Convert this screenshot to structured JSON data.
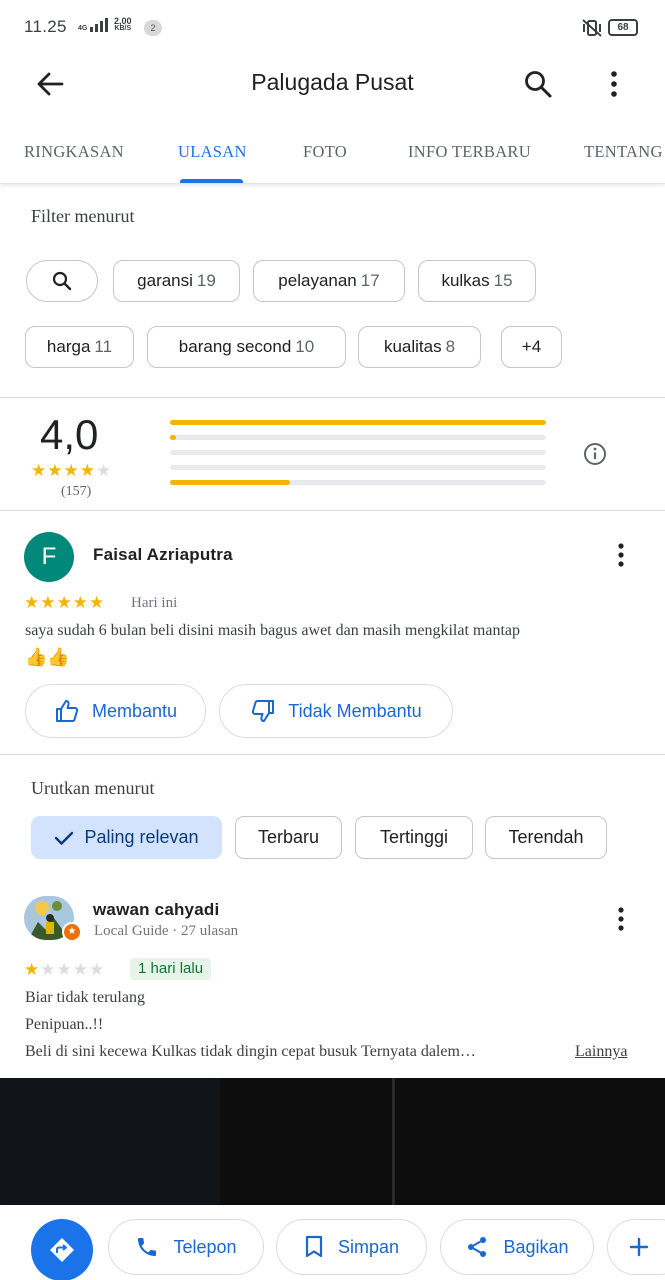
{
  "status_bar": {
    "time": "11.25",
    "network": "4G",
    "speed_value": "2,00",
    "speed_unit": "KB/S",
    "notification_count": "2",
    "battery": "68"
  },
  "app_bar": {
    "title": "Palugada Pusat",
    "icons": [
      "arrow-back-icon",
      "search-icon",
      "more-vert-icon"
    ]
  },
  "tabs": [
    {
      "label": "RINGKASAN",
      "active": false
    },
    {
      "label": "ULASAN",
      "active": true
    },
    {
      "label": "FOTO",
      "active": false
    },
    {
      "label": "INFO TERBARU",
      "active": false
    },
    {
      "label": "TENTANG",
      "active": false
    }
  ],
  "filter": {
    "label": "Filter menurut",
    "chips": [
      {
        "label": "garansi",
        "count": "19"
      },
      {
        "label": "pelayanan",
        "count": "17"
      },
      {
        "label": "kulkas",
        "count": "15"
      },
      {
        "label": "harga",
        "count": "11"
      },
      {
        "label": "barang second",
        "count": "10"
      },
      {
        "label": "kualitas",
        "count": "8"
      },
      {
        "label": "+4",
        "count": ""
      }
    ]
  },
  "rating_summary": {
    "average": "4,0",
    "stars": 4,
    "total_reviews": "(157)",
    "distribution": [
      {
        "stars": 5,
        "fraction": 1.0
      },
      {
        "stars": 4,
        "fraction": 0.01
      },
      {
        "stars": 3,
        "fraction": 0.0
      },
      {
        "stars": 2,
        "fraction": 0.0
      },
      {
        "stars": 1,
        "fraction": 0.32
      }
    ]
  },
  "featured_review": {
    "avatar_letter": "F",
    "avatar_color": "#00897b",
    "reviewer": "Faisal Azriaputra",
    "stars": 5,
    "date": "Hari ini",
    "text": "saya sudah 6 bulan beli disini masih bagus awet dan masih mengkilat mantap",
    "emoji": "👍👍",
    "helpful_label": "Membantu",
    "not_helpful_label": "Tidak Membantu"
  },
  "sort": {
    "label": "Urutkan menurut",
    "options": [
      {
        "label": "Paling relevan",
        "selected": true
      },
      {
        "label": "Terbaru",
        "selected": false
      },
      {
        "label": "Tertinggi",
        "selected": false
      },
      {
        "label": "Terendah",
        "selected": false
      }
    ]
  },
  "review_2": {
    "reviewer": "wawan cahyadi",
    "guide_line": "Local Guide · 27 ulasan",
    "stars": 1,
    "time": "1 hari lalu",
    "lines": [
      "Biar tidak terulang",
      "Penipuan..!!",
      "Beli di sini kecewa Kulkas tidak dingin cepat busuk Ternyata dalem…"
    ],
    "more_label": "Lainnya"
  },
  "bottom_bar": {
    "call_label": "Telepon",
    "save_label": "Simpan",
    "share_label": "Bagikan"
  },
  "colors": {
    "accent": "#1a73e8",
    "star": "#f4b400",
    "selected_chip": "#d3e3fd"
  }
}
